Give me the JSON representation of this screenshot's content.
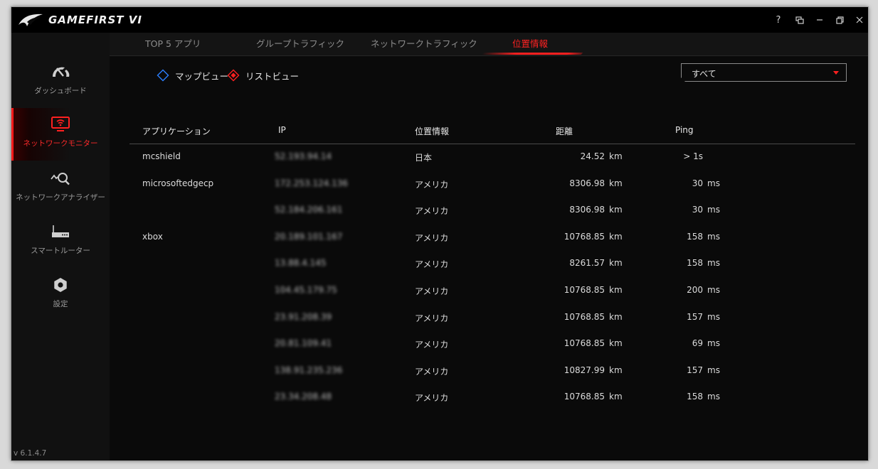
{
  "app": {
    "title": "GAMEFIRST VI",
    "version": "v 6.1.4.7"
  },
  "window_controls": {
    "help": "?"
  },
  "sidebar": {
    "items": [
      {
        "label": "ダッシュボード",
        "icon": "gauge-icon"
      },
      {
        "label": "ネットワークモニター",
        "icon": "monitor-wifi-icon",
        "active": true
      },
      {
        "label": "ネットワークアナライザー",
        "icon": "analyzer-icon"
      },
      {
        "label": "スマートルーター",
        "icon": "router-icon"
      },
      {
        "label": "設定",
        "icon": "gear-icon"
      }
    ]
  },
  "tabs": [
    {
      "label": "TOP 5 アプリ"
    },
    {
      "label": "グループトラフィック"
    },
    {
      "label": "ネットワークトラフィック"
    },
    {
      "label": "位置情報",
      "active": true
    }
  ],
  "view_options": {
    "map": "マップビュー",
    "list": "リストビュー",
    "selected": "list"
  },
  "filter": {
    "selected": "すべて"
  },
  "table": {
    "headers": {
      "app": "アプリケーション",
      "ip": "IP",
      "location": "位置情報",
      "distance": "距離",
      "ping": "Ping"
    },
    "rows": [
      {
        "app": "mcshield",
        "ip": "52.193.94.14",
        "location": "日本",
        "distance": "24.52",
        "distance_unit": "km",
        "ping": "> 1s",
        "ping_unit": ""
      },
      {
        "app": "microsoftedgecp",
        "ip": "172.253.124.136",
        "location": "アメリカ",
        "distance": "8306.98",
        "distance_unit": "km",
        "ping": "30",
        "ping_unit": "ms"
      },
      {
        "app": "",
        "ip": "52.184.206.161",
        "location": "アメリカ",
        "distance": "8306.98",
        "distance_unit": "km",
        "ping": "30",
        "ping_unit": "ms"
      },
      {
        "app": "xbox",
        "ip": "20.189.101.167",
        "location": "アメリカ",
        "distance": "10768.85",
        "distance_unit": "km",
        "ping": "158",
        "ping_unit": "ms"
      },
      {
        "app": "",
        "ip": "13.88.4.145",
        "location": "アメリカ",
        "distance": "8261.57",
        "distance_unit": "km",
        "ping": "158",
        "ping_unit": "ms"
      },
      {
        "app": "",
        "ip": "104.45.179.75",
        "location": "アメリカ",
        "distance": "10768.85",
        "distance_unit": "km",
        "ping": "200",
        "ping_unit": "ms"
      },
      {
        "app": "",
        "ip": "23.91.208.39",
        "location": "アメリカ",
        "distance": "10768.85",
        "distance_unit": "km",
        "ping": "157",
        "ping_unit": "ms"
      },
      {
        "app": "",
        "ip": "20.81.109.41",
        "location": "アメリカ",
        "distance": "10768.85",
        "distance_unit": "km",
        "ping": "69",
        "ping_unit": "ms"
      },
      {
        "app": "",
        "ip": "138.91.235.236",
        "location": "アメリカ",
        "distance": "10827.99",
        "distance_unit": "km",
        "ping": "157",
        "ping_unit": "ms"
      },
      {
        "app": "",
        "ip": "23.34.208.48",
        "location": "アメリカ",
        "distance": "10768.85",
        "distance_unit": "km",
        "ping": "158",
        "ping_unit": "ms"
      }
    ]
  },
  "colors": {
    "accent": "#ff2020",
    "background": "#0a0a0a",
    "sidebar": "#111111",
    "map_diamond": "#2a7fff"
  }
}
